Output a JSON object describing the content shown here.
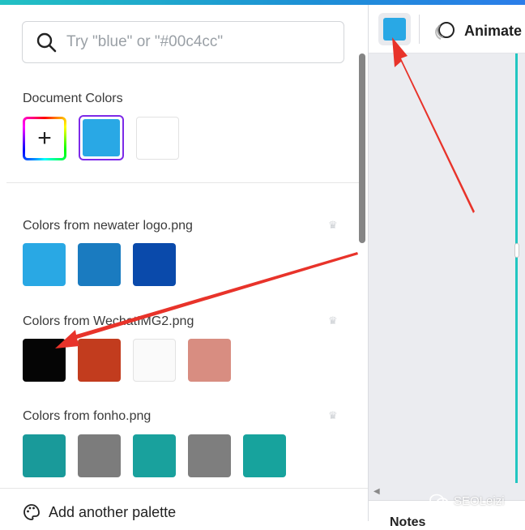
{
  "search": {
    "placeholder": "Try \"blue\" or \"#00c4cc\""
  },
  "document_colors": {
    "title": "Document Colors",
    "add_symbol": "+",
    "swatches": [
      "#29a8e5",
      "#ffffff"
    ]
  },
  "palettes": [
    {
      "title": "Colors from newater logo.png",
      "colors": [
        "#29a8e4",
        "#1a7bc0",
        "#0a4aab"
      ]
    },
    {
      "title": "Colors from WechatIMG2.png",
      "colors": [
        "#050505",
        "#c23c1e",
        "#fafafa",
        "#d88d81"
      ]
    },
    {
      "title": "Colors from fonho.png",
      "colors": [
        "#199a9a",
        "#7c7c7c",
        "#19a19d",
        "#7e7e7e",
        "#17a39d"
      ]
    }
  ],
  "bottom": {
    "add_palette_label": "Add another palette"
  },
  "toolbar": {
    "selected_color": "#29a8e5",
    "animate_label": "Animate"
  },
  "notes_label": "Notes",
  "watermark": "SEOLeizi",
  "annotation_color": "#e8332a",
  "canvas_edge_color": "#21c6c1"
}
